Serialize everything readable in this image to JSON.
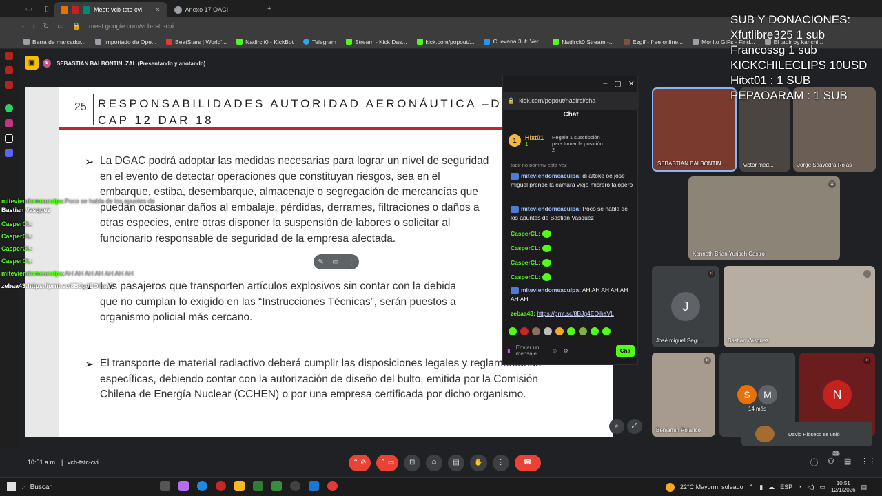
{
  "browser": {
    "tabs": [
      {
        "label": "Meet: vcb-tstc-cvi",
        "active": true
      },
      {
        "label": "Anexo 17 OACI",
        "active": false
      }
    ],
    "url": "meet.google.com/vcb-tstc-cvi",
    "bookmarks": [
      "Barra de marcador...",
      "Importado de Ope...",
      "BeatStars | World'...",
      "Nadirclt0 - KickBot",
      "Telegram",
      "Stream - Kick Das...",
      "kick.com/popout/...",
      "Cuevana 3 ⚜ Ver...",
      "Nadirclt0 Stream -...",
      "Ezgif - free online...",
      "Monito GIFs - Find...",
      "El tapir by kanchi..."
    ]
  },
  "meet": {
    "presenter_avatar": "S",
    "presenting_label": "SEBASTIAN BALBONTIN .ZAL (Presentando y anotando)",
    "clock": "10:51 a.m.",
    "separator": "|",
    "meeting_code": "vcb-tstc-cvi",
    "participants_count_badge": "23"
  },
  "slide": {
    "number": "25",
    "title": "RESPONSABILIDADES AUTORIDAD AERONÁUTICA –DGAC\nCAP 12 DAR 18",
    "bullet_glyph": "➢",
    "paragraphs": [
      "La DGAC podrá adoptar las medidas necesarias para lograr un nivel de seguridad\nen el evento de detectar operaciones que constituyan riesgos, sea en el\nembarque, estiba, desembarque, almacenaje o segregación de mercancías que\npuedan ocasionar daños al embalaje, pérdidas, derrames, filtraciones o daños a\notras especies, entre otras disponer la suspensión de labores o solicitar al\nfuncionario responsable de seguridad de la empresa afectada.",
      "Los pasajeros que transporten artículos explosivos sin contar con la debida\nque no cumplan lo exigido en las “Instrucciones Técnicas”, serán puestos a\norganismo policial más cercano.",
      "El transporte de material radiactivo deberá cumplir las disposiciones legales y reglamentarias\nespecíficas, debiendo contar con la autorización de diseño del bulto, emitida por la Comisión\nChilena de Energía Nuclear (CCHEN) o por una empresa certificada por dicho organismo."
    ]
  },
  "kick": {
    "url": "kick.com/popout/nadircl/cha",
    "chat_title": "Chat",
    "pinned": {
      "badge": "1",
      "user": "Hixt01",
      "count": "1",
      "message": "Regala 1 suscripción para tomar la posición 2"
    },
    "partial_top": "tapir no pommy esta vez",
    "messages": [
      {
        "user": "miteviendomeaculpa:",
        "text": "di altoke oe jose miguel prende la camara viejo micrero falopero",
        "style": "b"
      },
      {
        "user": "miteviendomeaculpa:",
        "text": "Poco se habla de los apuntes de Bastian Vasquez",
        "style": "b"
      },
      {
        "user": "CasperCL:",
        "text": "",
        "style": "g"
      },
      {
        "user": "CasperCL:",
        "text": "",
        "style": "g"
      },
      {
        "user": "CasperCL:",
        "text": "",
        "style": "g"
      },
      {
        "user": "CasperCL:",
        "text": "",
        "style": "g"
      },
      {
        "user": "miteviendomeaculpa:",
        "text": "AH AH AH AH AH AH AH",
        "style": "b"
      },
      {
        "user": "zebaa43:",
        "text": "https://prnt.sc/8BJg4EOihaVL",
        "style": "g"
      }
    ],
    "input_placeholder": "Enviar un mensaje",
    "send_label": "Cha"
  },
  "overlay_lines": [
    "SUB Y DONACIONES:",
    "Xfutlibre325 1 sub",
    "Francossg 1 sub",
    "KICKCHILECLIPS 10USD",
    "Hitxt01 : 1 SUB",
    "PEPAOARAM : 1 SUB"
  ],
  "left_chat": [
    {
      "user": "miteviendomeaculpa:",
      "text": "Poco se habla de los apuntes de"
    },
    {
      "user": "Bastian Vasquez",
      "text": ""
    },
    {
      "user": "CasperCL:",
      "text": ""
    },
    {
      "user": "CasperCL:",
      "text": ""
    },
    {
      "user": "CasperCL:",
      "text": ""
    },
    {
      "user": "CasperCL:",
      "text": ""
    },
    {
      "user": "miteviendomeaculpa:",
      "text": "AH AH AH AH AH AH AH"
    },
    {
      "user": "zebaa43:",
      "text": "https://prnt.sc/8BJg4EOihaVL"
    }
  ],
  "participants": [
    {
      "name": "SEBASTIAN BALBONTIN ..."
    },
    {
      "name": "victor med..."
    },
    {
      "name": "Jorge Saavedra Rojas"
    },
    {
      "name": "Kenneth Brian Yurisch Castro"
    },
    {
      "name": "José miguel Segu...",
      "letter": "J"
    },
    {
      "name": "Bastian Vasquez"
    },
    {
      "name": "Benjamín Polanco"
    },
    {
      "name": "14 más",
      "letters": [
        "S",
        "M"
      ]
    },
    {
      "name": "",
      "letter": "N"
    }
  ],
  "toast": "David Rioseco se unió",
  "taskbar": {
    "search_placeholder": "Buscar",
    "weather": "22°C  Mayorm. soleado",
    "lang": "ESP",
    "time": "10:51",
    "date": "12/1/2026"
  }
}
